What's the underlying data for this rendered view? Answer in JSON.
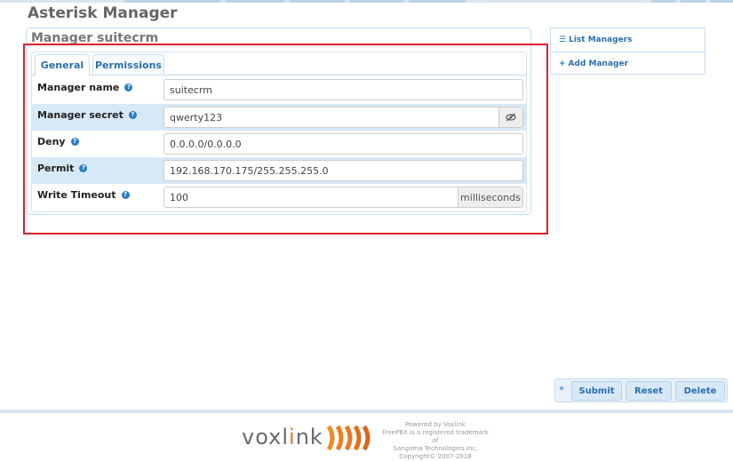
{
  "header": {
    "title": "Asterisk Manager"
  },
  "panel": {
    "title": "Manager suitecrm",
    "tabs": [
      {
        "label": "General",
        "active": true
      },
      {
        "label": "Permissions",
        "active": false
      }
    ]
  },
  "form": {
    "rows": [
      {
        "label": "Manager name",
        "value": "suitecrm"
      },
      {
        "label": "Manager secret",
        "value": "qwerty123",
        "addon_icon": "eye-slash-icon"
      },
      {
        "label": "Deny",
        "value": "0.0.0.0/0.0.0.0"
      },
      {
        "label": "Permit",
        "value": "192.168.170.175/255.255.255.0"
      },
      {
        "label": "Write Timeout",
        "value": "100",
        "addon": "milliseconds"
      }
    ]
  },
  "side_menu": {
    "items": [
      {
        "label": "List Managers",
        "icon": "list-icon"
      },
      {
        "label": "Add Manager",
        "icon": "plus-icon"
      }
    ]
  },
  "actions": {
    "submit": "Submit",
    "reset": "Reset",
    "delete": "Delete"
  },
  "footer": {
    "logo_text_a": "voxl",
    "logo_text_b": "i",
    "logo_text_c": "nk",
    "powered_by": "Powered by Voxlink",
    "trademark_1": "FreePBX is a registered trademark of",
    "trademark_2": "Sangoma Technologies Inc.",
    "copyright": "Copyright© 2007-2018"
  },
  "colors": {
    "accent": "#2a6fb0",
    "highlight": "#e0202a",
    "row_alt": "#d7e8f7",
    "logo_orange": "#e87722"
  }
}
